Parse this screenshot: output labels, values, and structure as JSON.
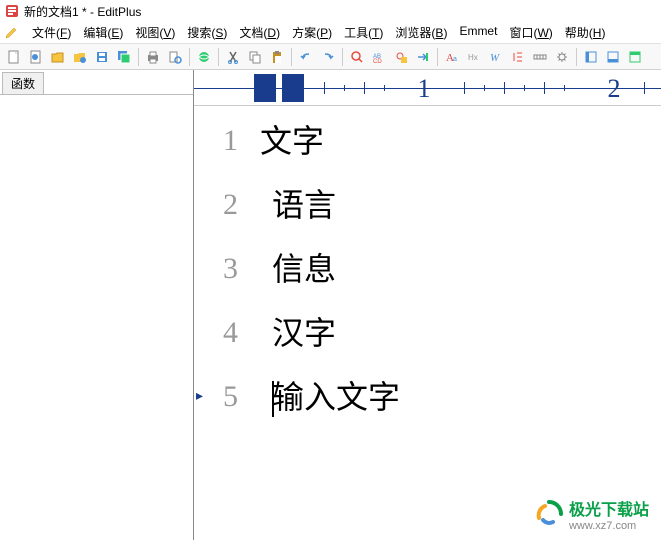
{
  "title": "新的文档1 * - EditPlus",
  "menu": {
    "items": [
      {
        "label": "文件",
        "key": "F"
      },
      {
        "label": "编辑",
        "key": "E"
      },
      {
        "label": "视图",
        "key": "V"
      },
      {
        "label": "搜索",
        "key": "S"
      },
      {
        "label": "文档",
        "key": "D"
      },
      {
        "label": "方案",
        "key": "P"
      },
      {
        "label": "工具",
        "key": "T"
      },
      {
        "label": "浏览器",
        "key": "B"
      },
      {
        "label": "Emmet",
        "key": ""
      },
      {
        "label": "窗口",
        "key": "W"
      },
      {
        "label": "帮助",
        "key": "H"
      }
    ]
  },
  "side": {
    "tab_label": "函数"
  },
  "ruler": {
    "n1": "1",
    "n2": "2"
  },
  "editor": {
    "lines": [
      {
        "n": "1",
        "text": "文字",
        "indent": false
      },
      {
        "n": "2",
        "text": "语言",
        "indent": true
      },
      {
        "n": "3",
        "text": "信息",
        "indent": true
      },
      {
        "n": "4",
        "text": "汉字",
        "indent": true
      },
      {
        "n": "5",
        "text": "输入文字",
        "indent": true,
        "cursor": true,
        "marker": true
      }
    ]
  },
  "watermark": {
    "name": "极光下载站",
    "url": "www.xz7.com"
  }
}
